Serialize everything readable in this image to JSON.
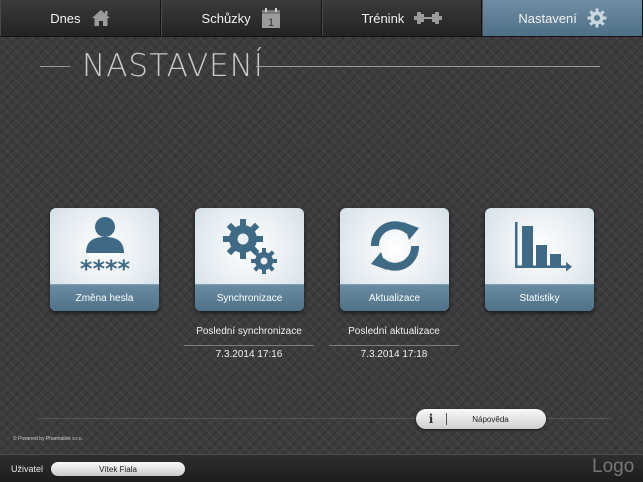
{
  "nav": {
    "tabs": [
      {
        "label": "Dnes",
        "icon": "home-icon",
        "active": false
      },
      {
        "label": "Schůzky",
        "icon": "calendar-icon",
        "calendar_day": "1",
        "active": false
      },
      {
        "label": "Trénink",
        "icon": "dumbbell-icon",
        "active": false
      },
      {
        "label": "Nastavení",
        "icon": "gear-icon",
        "active": true
      }
    ]
  },
  "page": {
    "title": "NASTAVENÍ"
  },
  "tiles": [
    {
      "label": "Změna hesla",
      "icon": "user-password-icon",
      "password_mask": "****"
    },
    {
      "label": "Synchronizace",
      "icon": "gears-icon"
    },
    {
      "label": "Aktualizace",
      "icon": "refresh-icon"
    },
    {
      "label": "Statistiky",
      "icon": "bar-chart-icon"
    }
  ],
  "sync_info": {
    "caption": "Poslední synchronizace",
    "value": "7.3.2014 17:16"
  },
  "update_info": {
    "caption": "Poslední aktualizace",
    "value": "7.3.2014 17:18"
  },
  "help": {
    "label": "Nápověda",
    "icon": "info-icon",
    "glyph": "i"
  },
  "powered_by": "© Powered by Pharmalink s.r.o.",
  "footer": {
    "user_label": "Uživatel",
    "user_name": "Vítek Fiala",
    "logo": "Logo"
  },
  "colors": {
    "accent": "#5a7d94",
    "tile_label": "#5a7d94",
    "icon": "#3f6a85",
    "background": "#3c3c3e"
  }
}
